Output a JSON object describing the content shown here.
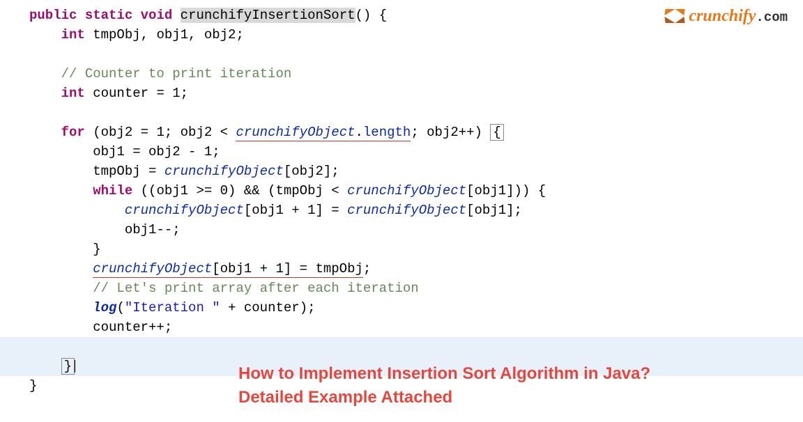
{
  "logo": {
    "brand": "crunchify",
    "suffix": ".com"
  },
  "title": {
    "line1": "How to Implement Insertion Sort Algorithm in Java?",
    "line2": "Detailed Example Attached"
  },
  "code": {
    "l1_kw1": "public",
    "l1_kw2": "static",
    "l1_kw3": "void",
    "l1_method": "crunchifyInsertionSort",
    "l1_paren": "() {",
    "l2_kw": "int",
    "l2_rest": " tmpObj, obj1, obj2;",
    "l4_comment": "// Counter to print iteration",
    "l5_kw": "int",
    "l5_rest": " counter = 1;",
    "l7_for": "for",
    "l7_open": " (obj2 = 1; obj2 < ",
    "l7_ident": "crunchifyObject",
    "l7_dot": ".",
    "l7_len_u": "length",
    "l7_semi": "; obj2++) ",
    "l7_brace": "{",
    "l8": "obj1 = obj2 - 1;",
    "l9_pre": "tmpObj = ",
    "l9_ident": "crunchifyObject",
    "l9_post": "[obj2];",
    "l10_while": "while",
    "l10_pre": " ((obj1 >= 0) && (tmpObj < ",
    "l10_ident": "crunchifyObject",
    "l10_post": "[obj1])) {",
    "l11_ident1": "crunchifyObject",
    "l11_mid": "[obj1 + 1] = ",
    "l11_ident2": "crunchifyObject",
    "l11_post": "[obj1];",
    "l12": "obj1--;",
    "l13": "}",
    "l14_ident_u": "crunchifyObject",
    "l14_mid_u": "[obj1 + 1] = tmpObj",
    "l14_semi": ";",
    "l15_comment": "// Let's print array after each iteration",
    "l16_log": "log",
    "l16_open": "(",
    "l16_str": "\"Iteration \"",
    "l16_rest": " + counter);",
    "l17": "counter++;",
    "l19": "}",
    "l20": "}"
  }
}
